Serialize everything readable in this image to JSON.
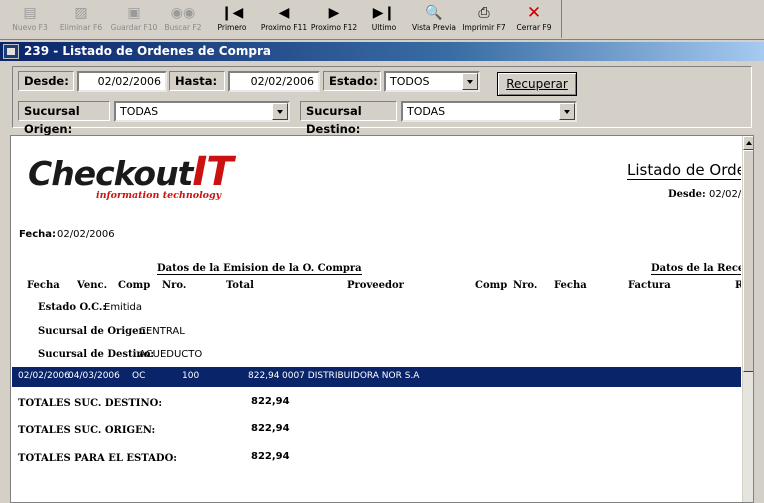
{
  "toolbar": {
    "buttons": [
      {
        "label": "Nuevo F3",
        "icon": "new-record-icon",
        "enabled": false
      },
      {
        "label": "Eliminar F6",
        "icon": "delete-record-icon",
        "enabled": false
      },
      {
        "label": "Guardar F10",
        "icon": "save-icon",
        "enabled": false
      },
      {
        "label": "Buscar F2",
        "icon": "binoculars-icon",
        "enabled": false
      },
      {
        "label": "Primero",
        "icon": "first-record-icon",
        "enabled": true
      },
      {
        "label": "Proximo F11",
        "icon": "previous-record-icon",
        "enabled": true
      },
      {
        "label": "Proximo F12",
        "icon": "next-record-icon",
        "enabled": true
      },
      {
        "label": "Ultimo",
        "icon": "last-record-icon",
        "enabled": true
      },
      {
        "label": "Vista Previa",
        "icon": "print-preview-icon",
        "enabled": true
      },
      {
        "label": "Imprimir F7",
        "icon": "printer-icon",
        "enabled": true
      },
      {
        "label": "Cerrar F9",
        "icon": "close-x-icon",
        "enabled": true
      }
    ]
  },
  "window": {
    "title": "239 - Listado de Ordenes de Compra"
  },
  "filters": {
    "desde_label": "Desde:",
    "desde_value": "02/02/2006",
    "hasta_label": "Hasta:",
    "hasta_value": "02/02/2006",
    "estado_label": "Estado:",
    "estado_value": "TODOS",
    "recuperar_label": "Recuperar",
    "sucursal_origen_label": "Sucursal Origen:",
    "sucursal_origen_value": "TODAS",
    "sucursal_destino_label": "Sucursal Destino:",
    "sucursal_destino_value": "TODAS"
  },
  "report": {
    "logo_text": "Checkout",
    "logo_it": "IT",
    "logo_tagline": "information technology",
    "title": "Listado de Orde",
    "desde_label": "Desde:",
    "desde_value": "02/02/",
    "fecha_label": "Fecha:",
    "fecha_value": "02/02/2006",
    "group_emision": "Datos de la Emision de la O. Compra",
    "group_recepcion": "Datos de la Recepci",
    "columns": [
      "Fecha",
      "Venc.",
      "Comp",
      "Nro.",
      "Total",
      "Proveedor",
      "Comp",
      "Nro.",
      "Fecha",
      "Factura",
      "R"
    ],
    "estado_label": "Estado O.C.:",
    "estado_value": "Emitida",
    "suc_origen_label": "Sucursal de Origen:",
    "suc_origen_value": "CENTRAL",
    "suc_destino_label": "Sucursal de Destino:",
    "suc_destino_value": "ACUEDUCTO",
    "row": {
      "fecha": "02/02/2006",
      "venc": "04/03/2006",
      "comp": "OC",
      "nro": "100",
      "total": "822,94",
      "proveedor": "0007 DISTRIBUIDORA NOR S.A"
    },
    "totales": [
      {
        "label": "TOTALES SUC. DESTINO:",
        "value": "822,94"
      },
      {
        "label": "TOTALES SUC. ORIGEN:",
        "value": "822,94"
      },
      {
        "label": "TOTALES PARA EL ESTADO:",
        "value": "822,94"
      }
    ]
  }
}
